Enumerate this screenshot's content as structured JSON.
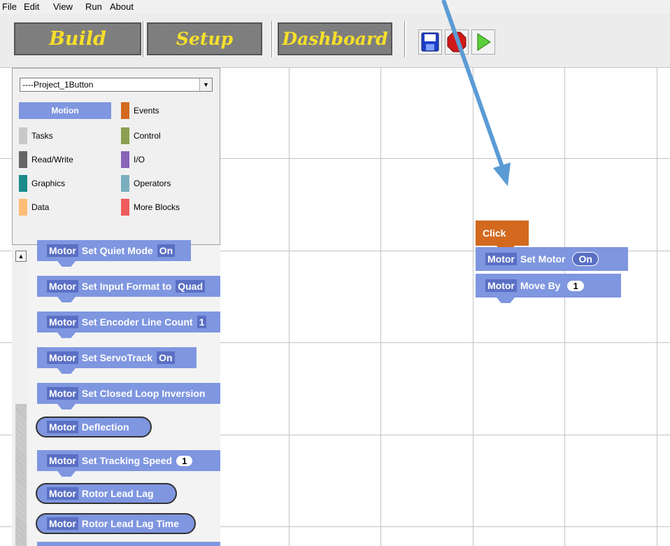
{
  "menu": [
    "File",
    "Edit",
    "View",
    "Run",
    "About"
  ],
  "tabs": {
    "build": "Build",
    "setup": "Setup",
    "dashboard": "Dashboard"
  },
  "toolbar_buttons": [
    "save-icon",
    "stop-icon",
    "run-icon"
  ],
  "palette": {
    "project": "----Project_1Button",
    "categories_left": [
      {
        "label": "Motion",
        "color": "#7f96e0",
        "selected": true
      },
      {
        "label": "Tasks",
        "color": "#c8c8c8"
      },
      {
        "label": "Read/Write",
        "color": "#666666"
      },
      {
        "label": "Graphics",
        "color": "#1a8a8a"
      },
      {
        "label": "Data",
        "color": "#fdbd77"
      }
    ],
    "categories_right": [
      {
        "label": "Events",
        "color": "#d2691e"
      },
      {
        "label": "Control",
        "color": "#8aa050"
      },
      {
        "label": "I/O",
        "color": "#8a63b8"
      },
      {
        "label": "Operators",
        "color": "#7aafbf"
      },
      {
        "label": "More Blocks",
        "color": "#ef5b5b"
      }
    ]
  },
  "block_list": [
    {
      "tag": "Motor",
      "text": "Set Quiet Mode",
      "value": "On",
      "kind": "cmd"
    },
    {
      "tag": "Motor",
      "text": "Set Input Format to",
      "value": "Quad",
      "kind": "cmd"
    },
    {
      "tag": "Motor",
      "text": "Set Encoder Line Count",
      "value": "1",
      "kind": "cmd"
    },
    {
      "tag": "Motor",
      "text": "Set ServoTrack",
      "value": "On",
      "kind": "cmd"
    },
    {
      "tag": "Motor",
      "text": "Set Closed Loop Inversion",
      "value": "",
      "kind": "cmd"
    },
    {
      "tag": "Motor",
      "text": "Deflection",
      "value": "",
      "kind": "reporter"
    },
    {
      "tag": "Motor",
      "text": "Set Tracking Speed",
      "value": "1",
      "kind": "cmd"
    },
    {
      "tag": "Motor",
      "text": "Rotor Lead Lag",
      "value": "",
      "kind": "reporter"
    },
    {
      "tag": "Motor",
      "text": "Rotor Lead Lag Time",
      "value": "",
      "kind": "reporter"
    }
  ],
  "script": {
    "hat": "Click",
    "blocks": [
      {
        "tag": "Motor",
        "text": "Set Motor",
        "value": "On"
      },
      {
        "tag": "Motor",
        "text": "Move By",
        "value": "1"
      }
    ]
  }
}
